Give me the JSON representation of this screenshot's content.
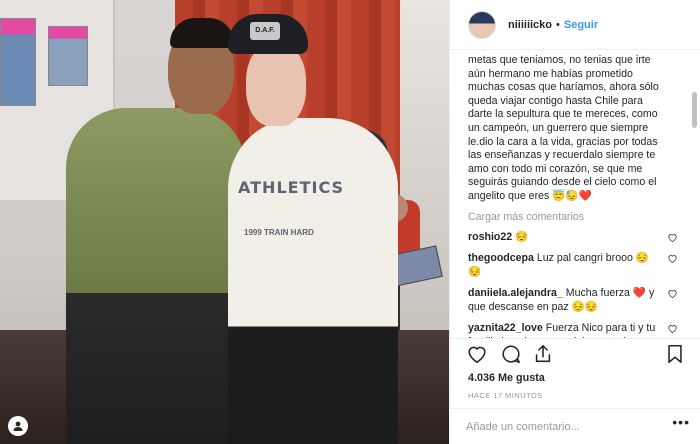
{
  "post": {
    "username": "niiiiiicko",
    "separator": "•",
    "follow_label": "Seguir"
  },
  "caption": "metas que teniamos, no tenias que irte aún hermano me habías prometido muchas cosas que haríamos, ahora sólo queda viajar contigo hasta Chile para darte la sepultura que te mereces, como un campeón, un guerrero que siempre le.dio la cara a la vida, gracias por todas las enseñanzas y recuerdalo siempre te amo con todo mi corazón, se que me seguirás guiando desde el cielo como el angelito que eres 😇😓❤️",
  "load_more": "Cargar más comentarios",
  "comments": [
    {
      "user": "roshio22",
      "text": "😔"
    },
    {
      "user": "thegoodcepa",
      "text": "Luz pal cangri brooo 😔😔"
    },
    {
      "user": "daniiela.alejandra_",
      "text": "Mucha fuerza ❤️ y que descanse en paz 😔😔"
    },
    {
      "user": "yaznita22_love",
      "text": "Fuerza Nico para ti y tu familia imagino como debe estar la"
    }
  ],
  "likes": "4.036 Me gusta",
  "time": "HACE 17 MINUTOS",
  "add_comment_placeholder": "Añade un comentario...",
  "more_dots": "•••",
  "photo_text": {
    "shirt": "ATHLETICS",
    "shirt_sub": "1999 TRAIN HARD",
    "cap": "D.A.F."
  },
  "icons": {
    "heart": "heart-icon",
    "comment": "comment-icon",
    "share": "share-icon",
    "save": "bookmark-icon"
  },
  "colors": {
    "link": "#3897f0",
    "text": "#262626",
    "muted": "#999999"
  }
}
